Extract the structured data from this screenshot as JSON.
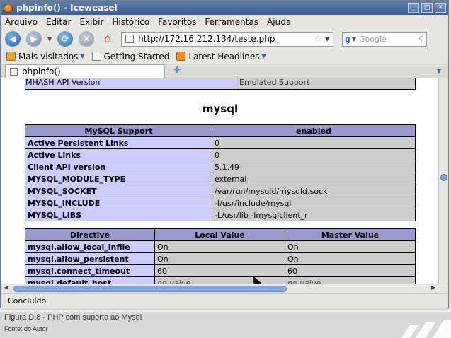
{
  "window": {
    "title": "phpinfo() - Iceweasel"
  },
  "menubar": {
    "items": [
      "Arquivo",
      "Editar",
      "Exibir",
      "Histórico",
      "Favoritos",
      "Ferramentas",
      "Ajuda"
    ]
  },
  "navbar": {
    "url": "http://172.16.212.134/teste.php",
    "search_placeholder": "Google",
    "home_icon": "home-icon"
  },
  "bookmarks": {
    "items": [
      "Mais visitados",
      "Getting Started",
      "Latest Headlines"
    ]
  },
  "tabs": [
    {
      "label": "phpinfo()"
    }
  ],
  "page": {
    "stub_row_label": "MHASH API Version",
    "stub_row_value": "Emulated Support",
    "section_title": "mysql",
    "mysql_table": {
      "headers": [
        "MySQL Support",
        "enabled"
      ],
      "rows": [
        [
          "Active Persistent Links",
          "0"
        ],
        [
          "Active Links",
          "0"
        ],
        [
          "Client API version",
          "5.1.49"
        ],
        [
          "MYSQL_MODULE_TYPE",
          "external"
        ],
        [
          "MYSQL_SOCKET",
          "/var/run/mysqld/mysqld.sock"
        ],
        [
          "MYSQL_INCLUDE",
          "-I/usr/include/mysql"
        ],
        [
          "MYSQL_LIBS",
          "-L/usr/lib -lmysqlclient_r"
        ]
      ]
    },
    "directive_table": {
      "headers": [
        "Directive",
        "Local Value",
        "Master Value"
      ],
      "rows": [
        [
          "mysql.allow_local_infile",
          "On",
          "On"
        ],
        [
          "mysql.allow_persistent",
          "On",
          "On"
        ],
        [
          "mysql.connect_timeout",
          "60",
          "60"
        ],
        [
          "mysql.default_host",
          "no value",
          "no value"
        ]
      ]
    }
  },
  "statusbar": {
    "text": "Concluído"
  },
  "caption": {
    "figure": "Figura D.8 - PHP com suporte ao Mysql",
    "source": "Fonte: do Autor"
  }
}
